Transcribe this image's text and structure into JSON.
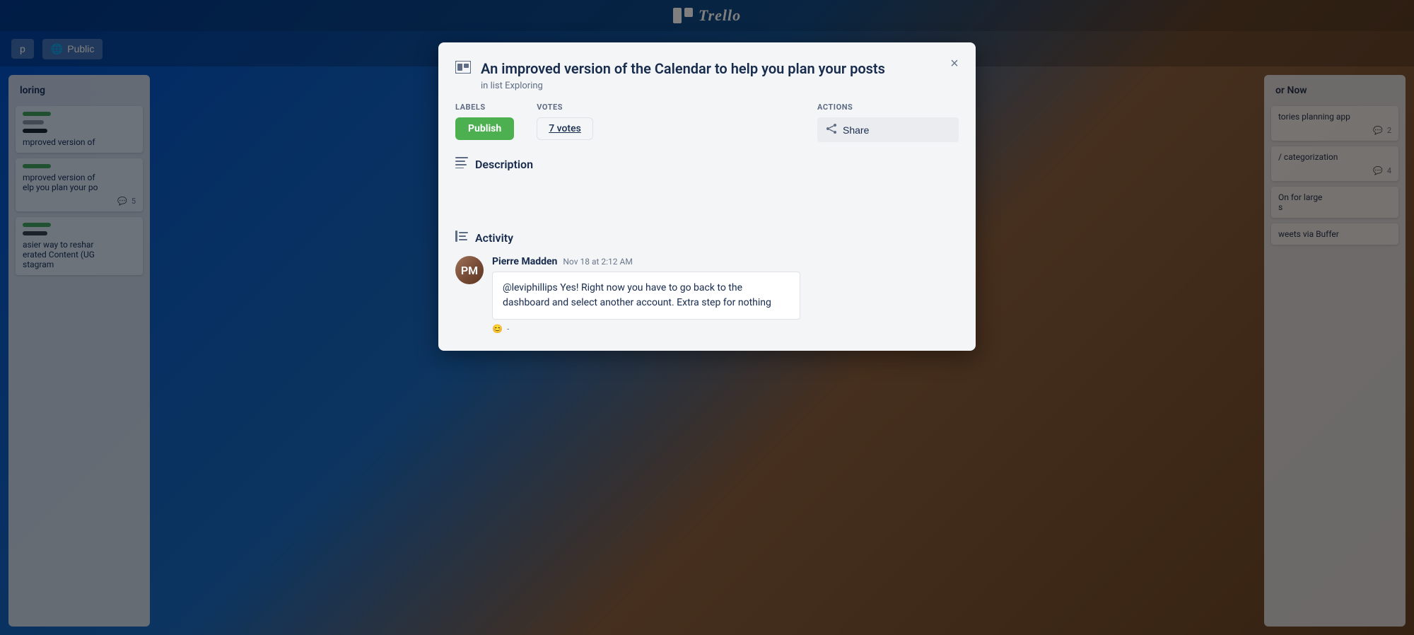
{
  "header": {
    "logo_text": "Trello",
    "board_name": "p",
    "visibility_label": "Public"
  },
  "background": {
    "left_column_title": "loring",
    "left_column_cards": [
      {
        "text": "mproved version of",
        "label_color": "#4caf50",
        "label2_color": "#9e9e9e",
        "label3_color": "#212121"
      },
      {
        "text": "mproved version of\nelp you plan your po",
        "label_color": "#4caf50",
        "comments": "5"
      },
      {
        "text": "asier way to reshar\nerated Content (UG\nstagram",
        "label_color": "#4caf50",
        "label2_color": "#424242"
      }
    ],
    "right_column_title": "or Now",
    "right_column_cards": [
      {
        "text": "tories planning app",
        "comments": "2"
      },
      {
        "text": "/ categorization",
        "comments": "4"
      },
      {
        "text": "On for large\ns"
      },
      {
        "text": "weets via Buffer"
      }
    ]
  },
  "modal": {
    "title": "An improved version of the Calendar to help you plan your posts",
    "subtitle": "in list Exploring",
    "close_label": "×",
    "labels_heading": "LABELS",
    "label_badge": "Publish",
    "votes_heading": "VOTES",
    "votes_text": "7 votes",
    "description_heading": "Description",
    "activity_heading": "Activity",
    "actions_heading": "ACTIONS",
    "share_label": "Share",
    "comments": [
      {
        "author": "Pierre Madden",
        "time": "Nov 18 at 2:12 AM",
        "avatar_initials": "PM",
        "text": "@leviphillips Yes! Right now you have to go back to the dashboard and select another account. Extra step for nothing",
        "emoji": "😊",
        "reaction": "-"
      }
    ]
  }
}
